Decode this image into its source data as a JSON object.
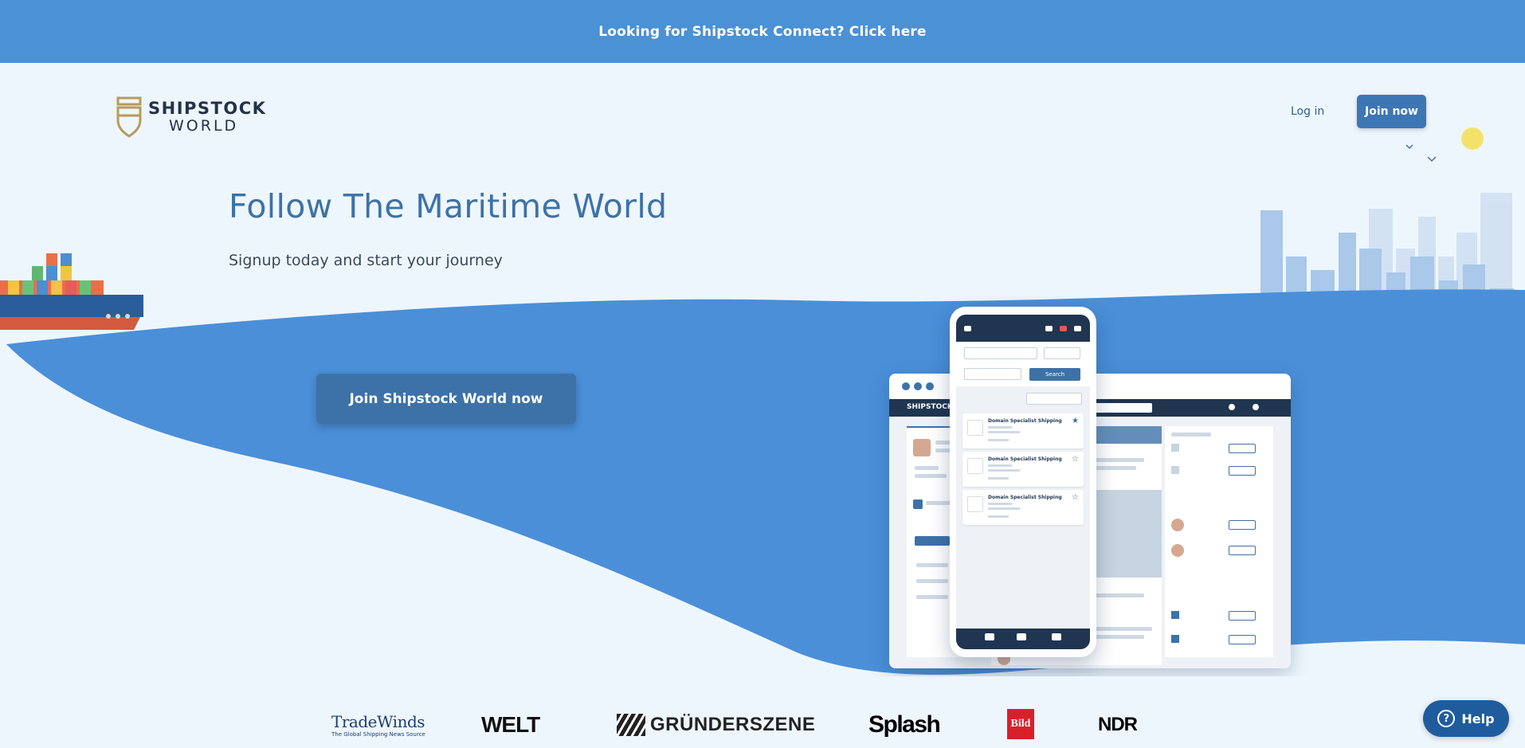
{
  "banner": {
    "text": "Looking for Shipstock Connect? Click here"
  },
  "header": {
    "logo_line1": "SHIPSTOCK",
    "logo_line2": "WORLD",
    "login_label": "Log in",
    "join_label": "Join now"
  },
  "hero": {
    "title": "Follow The Maritime World",
    "subtitle": "Signup today and start your journey",
    "cta_label": "Join Shipstock World now"
  },
  "mockup": {
    "desktop_brand": "SHIPSTOCK",
    "phone_search_label": "Search",
    "phone_cards": [
      {
        "title": "Domain Specialist Shipping"
      },
      {
        "title": "Domain Specialist Shipping"
      },
      {
        "title": "Domain Specialist Shipping"
      }
    ]
  },
  "press": {
    "tradewinds": "TradeWinds",
    "tradewinds_tag": "The Global Shipping News Source",
    "welt": "WELT",
    "gruenderszene": "GRÜNDERSZENE",
    "splash": "Splash",
    "bild": "Bild",
    "ndr": "NDR"
  },
  "help": {
    "label": "Help"
  },
  "colors": {
    "banner": "#4a91d6",
    "primary": "#3d72a8",
    "wave": "#4a8fd8",
    "page_bg": "#eef6fd"
  }
}
